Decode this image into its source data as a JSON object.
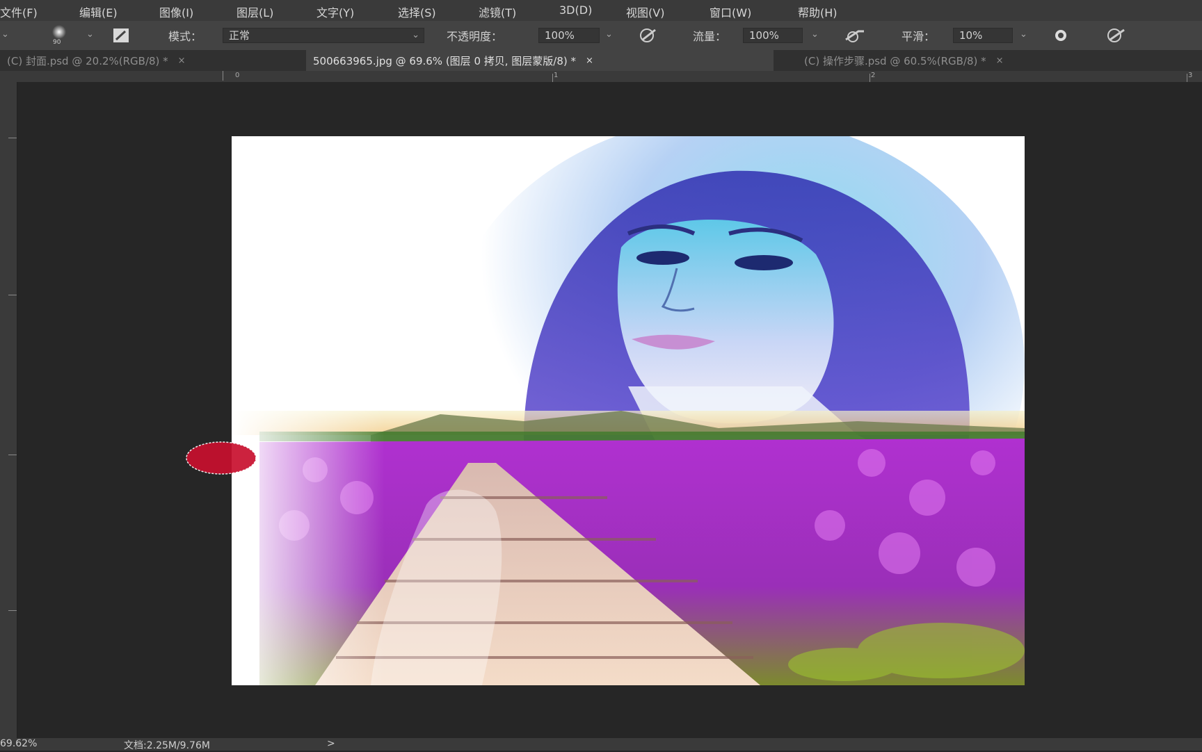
{
  "menu": {
    "items": [
      "文件(F)",
      "编辑(E)",
      "图像(I)",
      "图层(L)",
      "文字(Y)",
      "选择(S)",
      "滤镜(T)",
      "3D(D)",
      "视图(V)",
      "窗口(W)",
      "帮助(H)"
    ]
  },
  "options": {
    "brush_size": "90",
    "mode_label": "模式：",
    "mode_value": "正常",
    "opacity_label": "不透明度：",
    "opacity_value": "100%",
    "flow_label": "流量：",
    "flow_value": "100%",
    "smoothing_label": "平滑：",
    "smoothing_value": "10%"
  },
  "tabs": [
    {
      "title": "(C) 封面.psd @ 20.2%(RGB/8) *",
      "close": "×",
      "active": false
    },
    {
      "title": "500663965.jpg @ 69.6% (图层 0 拷贝, 图层蒙版/8) *",
      "close": "×",
      "active": true
    },
    {
      "title": "(C) 操作步骤.psd @ 60.5%(RGB/8) *",
      "close": "×",
      "active": false
    }
  ],
  "ruler": {
    "top_labels": [
      "0",
      "1",
      "2",
      "3"
    ]
  },
  "status": {
    "zoom": "69.62%",
    "doc_size": "文档:2.25M/9.76M",
    "arrow": ">"
  },
  "colors": {
    "brush_cursor": "#c8102e",
    "ui_dark": "#262626"
  }
}
